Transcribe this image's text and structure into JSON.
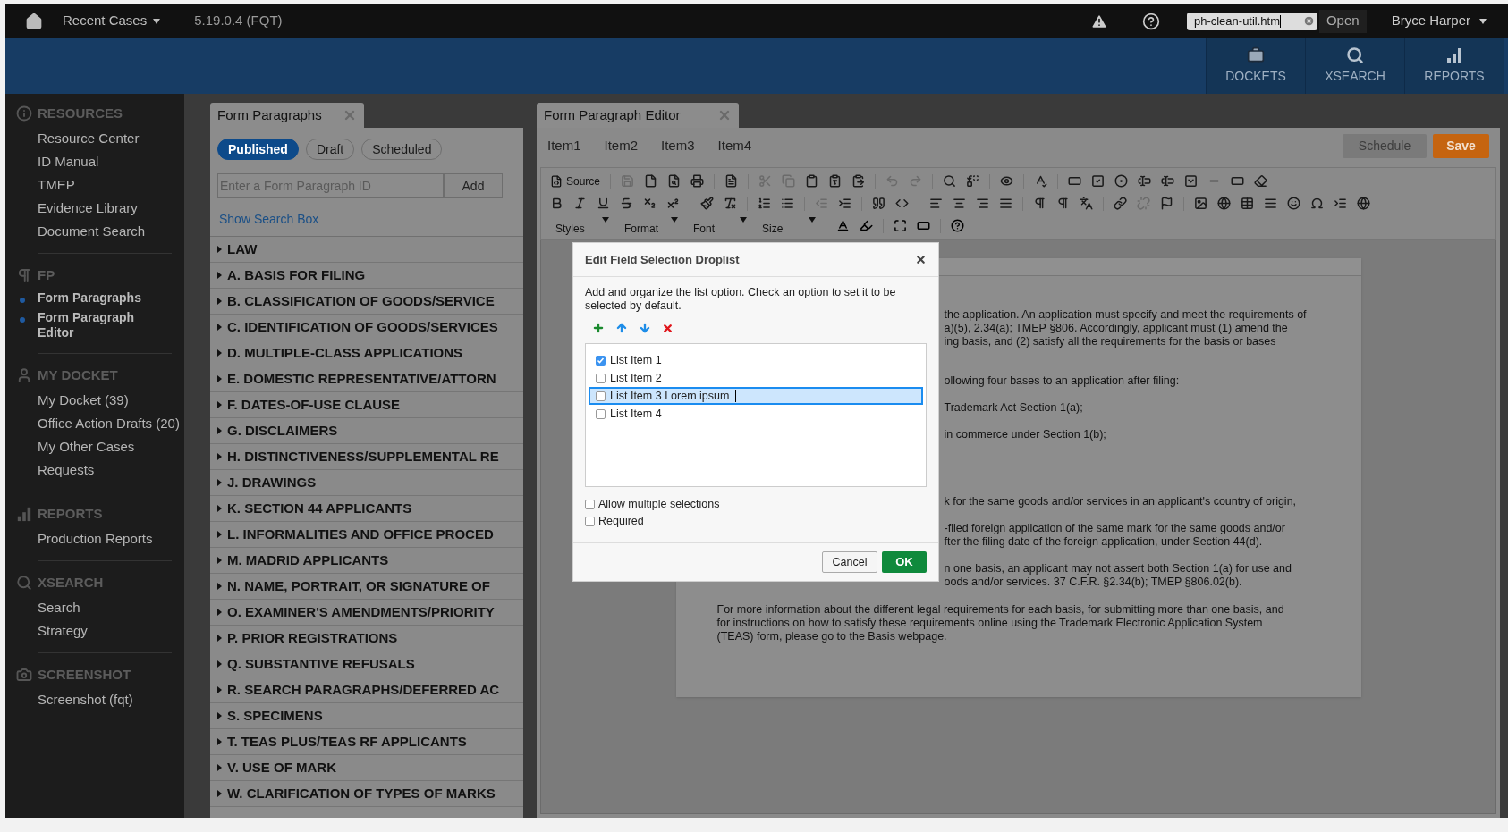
{
  "top_bar": {
    "recent_cases": "Recent Cases",
    "version": "5.19.0.4 (FQT)",
    "file_field": {
      "value": "ph-clean-util.htm"
    },
    "open": "Open",
    "user": "Bryce Harper"
  },
  "nav_tiles": [
    "DOCKETS",
    "XSEARCH",
    "REPORTS"
  ],
  "sidebar": [
    {
      "title": "RESOURCES",
      "items": [
        {
          "label": "Resource Center",
          "selected": false
        },
        {
          "label": "ID Manual",
          "selected": false
        },
        {
          "label": "TMEP",
          "selected": false
        },
        {
          "label": "Evidence Library",
          "selected": false
        },
        {
          "label": "Document Search",
          "selected": false
        }
      ]
    },
    {
      "title": "FP",
      "items": [
        {
          "label": "Form Paragraphs",
          "selected": true
        },
        {
          "label": "Form Paragraph Editor",
          "selected": true
        }
      ]
    },
    {
      "title": "MY DOCKET",
      "items": [
        {
          "label": "My Docket (39)",
          "selected": false
        },
        {
          "label": "Office Action Drafts (20)",
          "selected": false
        },
        {
          "label": "My Other Cases",
          "selected": false
        },
        {
          "label": "Requests",
          "selected": false
        }
      ]
    },
    {
      "title": "REPORTS",
      "items": [
        {
          "label": "Production Reports",
          "selected": false
        }
      ]
    },
    {
      "title": "XSEARCH",
      "items": [
        {
          "label": "Search",
          "selected": false
        },
        {
          "label": "Strategy",
          "selected": false
        }
      ]
    },
    {
      "title": "SCREENSHOT",
      "items": [
        {
          "label": "Screenshot (fqt)",
          "selected": false
        }
      ]
    }
  ],
  "form_paragraphs": {
    "title": "Form Paragraphs",
    "filters": [
      {
        "label": "Published",
        "selected": true
      },
      {
        "label": "Draft",
        "selected": false
      },
      {
        "label": "Scheduled",
        "selected": false
      }
    ],
    "id_field": {
      "placeholder": "Enter a Form Paragraph ID"
    },
    "add": "Add",
    "show_search": "Show Search Box",
    "sections": [
      "LAW",
      "A. BASIS FOR FILING",
      "B. CLASSIFICATION OF GOODS/SERVICE",
      "C. IDENTIFICATION OF GOODS/SERVICES",
      "D. MULTIPLE-CLASS APPLICATIONS",
      "E. DOMESTIC REPRESENTATIVE/ATTORN",
      "F. DATES-OF-USE CLAUSE",
      "G. DISCLAIMERS",
      "H. DISTINCTIVENESS/SUPPLEMENTAL RE",
      "J. DRAWINGS",
      "K. SECTION 44 APPLICANTS",
      "L. INFORMALITIES AND OFFICE PROCED",
      "M. MADRID APPLICANTS",
      "N. NAME, PORTRAIT, OR SIGNATURE OF",
      "O. EXAMINER'S AMENDMENTS/PRIORITY",
      "P. PRIOR REGISTRATIONS",
      "Q. SUBSTANTIVE REFUSALS",
      "R. SEARCH PARAGRAPHS/DEFERRED AC",
      "S. SPECIMENS",
      "T. TEAS PLUS/TEAS RF APPLICANTS",
      "V. USE OF MARK",
      "W. CLARIFICATION OF TYPES OF MARKS"
    ]
  },
  "editor": {
    "title": "Form Paragraph Editor",
    "items": [
      "Item1",
      "Item2",
      "Item3",
      "Item4"
    ],
    "schedule": "Schedule",
    "save": "Save",
    "toolbar": {
      "source": "Source",
      "combos": [
        "Styles",
        "Format",
        "Font",
        "Size"
      ]
    },
    "document": {
      "fragments": [
        [
          "the application. An application must specify and meet the requirements of",
          "a)(5), 2.34(a); TMEP §806. Accordingly, applicant must (1) amend the",
          "ing basis, and (2) satisfy all the requirements for the basis or bases"
        ],
        [
          "ollowing four bases to an application after filing:"
        ],
        [
          "Trademark Act Section 1(a);"
        ],
        [
          "in commerce under Section 1(b);"
        ],
        [
          "k for the same goods and/or services in an applicant's country of origin,"
        ],
        [
          "-filed foreign application of the same mark for the same goods and/or",
          "fter the filing date of the foreign application, under Section 44(d)."
        ],
        [
          "n one basis, an applicant may not assert both Section 1(a) for use and",
          "oods and/or services. 37 C.F.R. §2.34(b); TMEP §806.02(b)."
        ]
      ],
      "paragraph": "For more information about the different legal requirements for each basis, for submitting more than one basis, and for instructions on how to satisfy these requirements online using the Trademark Electronic Application System (TEAS) form, please go to the Basis webpage."
    }
  },
  "dialog": {
    "title": "Edit Field Selection Droplist",
    "instruction": "Add and organize the list option. Check an option to set it to be selected by default.",
    "options": [
      {
        "label": "List Item 1",
        "checked": true,
        "selected": false
      },
      {
        "label": "List Item 2",
        "checked": false,
        "selected": false
      },
      {
        "label": "List Item 3 Lorem ipsum",
        "checked": false,
        "selected": true
      },
      {
        "label": "List Item 4",
        "checked": false,
        "selected": false
      }
    ],
    "settings": [
      {
        "label": "Allow multiple selections",
        "checked": false
      },
      {
        "label": "Required",
        "checked": false
      }
    ],
    "cancel": "Cancel",
    "ok": "OK"
  }
}
